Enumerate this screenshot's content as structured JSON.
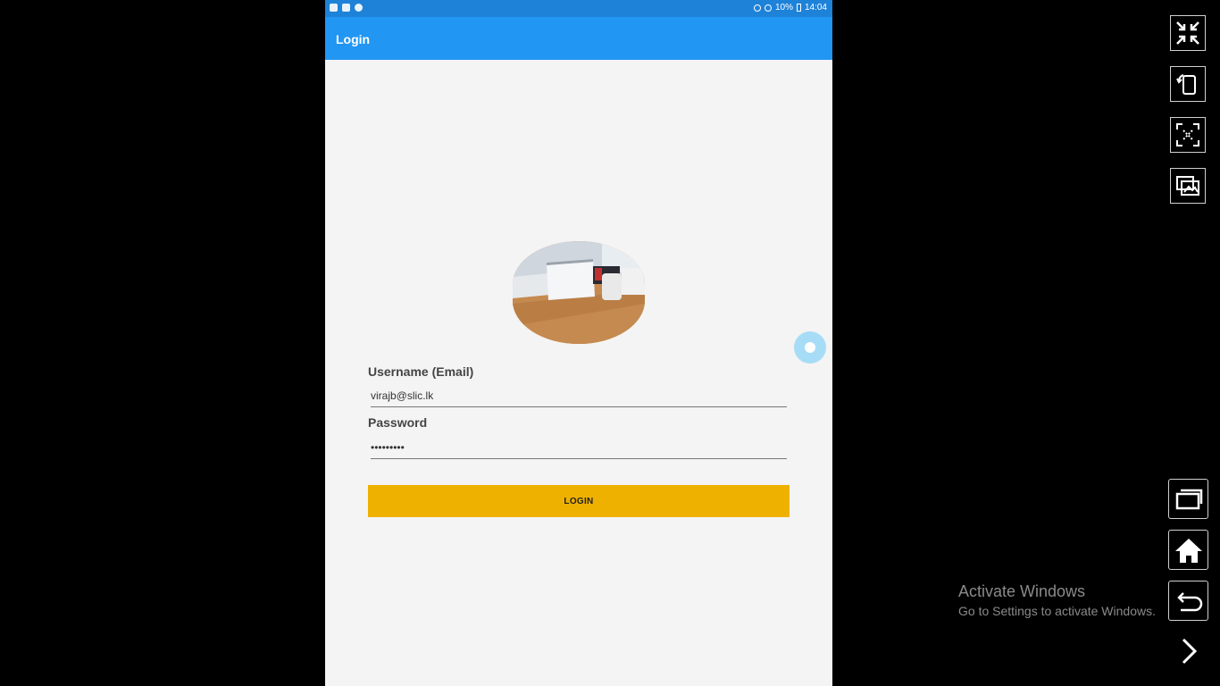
{
  "status_bar": {
    "battery": "10%",
    "time": "14:04"
  },
  "app_bar": {
    "title": "Login"
  },
  "form": {
    "username_label": "Username (Email)",
    "username_value": "virajb@slic.lk",
    "password_label": "Password",
    "password_value": "•••••••••",
    "login_button": "LOGIN"
  },
  "watermark": {
    "line1": "Activate Windows",
    "line2": "Go to Settings to activate Windows."
  },
  "side_controls": [
    "exit-fullscreen-icon",
    "rotate-icon",
    "screenshot-icon",
    "gallery-icon",
    "recent-apps-icon",
    "home-icon",
    "back-icon",
    "chevron-right-icon"
  ],
  "colors": {
    "app_bar": "#2196f3",
    "status_bar": "#1e82d8",
    "login_button": "#efb100",
    "background": "#f4f4f4"
  }
}
